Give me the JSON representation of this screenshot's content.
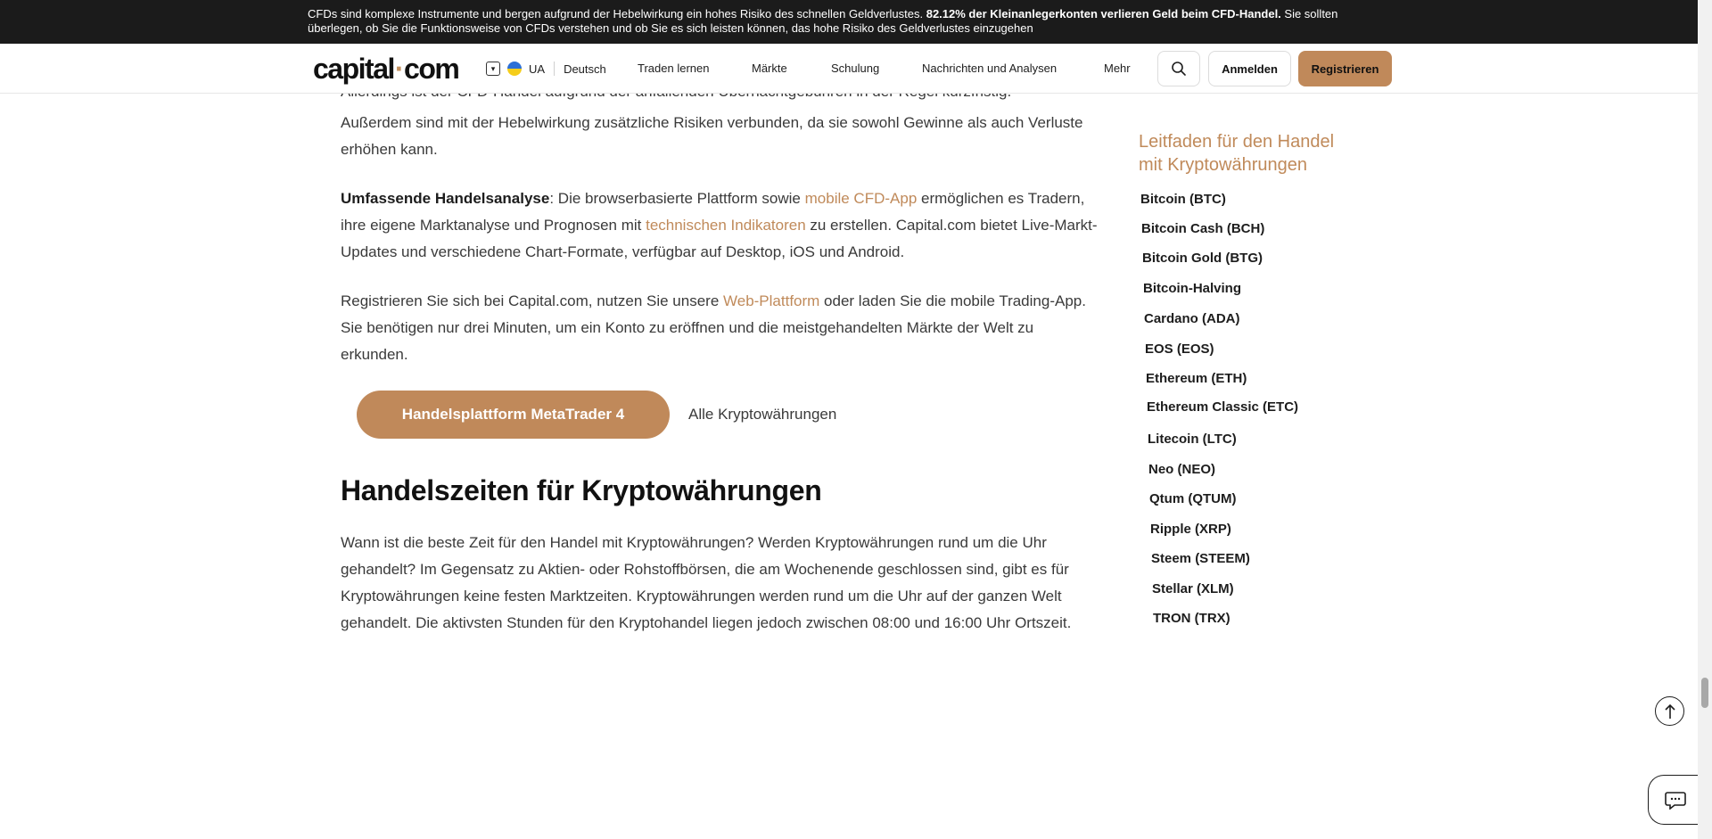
{
  "risk_banner": {
    "text_before": "CFDs sind komplexe Instrumente und bergen aufgrund der Hebelwirkung ein hohes Risiko des schnellen Geldverlustes. ",
    "text_bold": "82.12% der Kleinanlegerkonten verlieren Geld beim CFD-Handel.",
    "text_after": " Sie sollten überlegen, ob Sie die Funktionsweise von CFDs verstehen und ob Sie es sich leisten können, das hohe Risiko des Geldverlustes einzugehen"
  },
  "header": {
    "logo_left": "capital",
    "logo_dot": "·",
    "logo_right": "com",
    "region": "UA",
    "language": "Deutsch",
    "nav": [
      "Traden lernen",
      "Märkte",
      "Schulung",
      "Nachrichten und Analysen",
      "Mehr"
    ],
    "login_label": "Anmelden",
    "register_label": "Registrieren"
  },
  "article": {
    "clipped_line": "Allerdings ist der CFD-Handel aufgrund der anfallenden Übernachtgebühren in der Regel kurzfristig.",
    "para1": "Außerdem sind mit der Hebelwirkung zusätzliche Risiken verbunden, da sie sowohl Gewinne als auch Verluste erhöhen kann.",
    "para2": {
      "bold": "Umfassende Handelsanalyse",
      "t1": ": Die browserbasierte Plattform sowie ",
      "link1": "mobile CFD-App",
      "t2": " ermöglichen es Tradern, ihre eigene Marktanalyse und Prognosen mit ",
      "link2": "technischen Indikatoren",
      "t3": " zu erstellen. Capital.com bietet Live-Markt-Updates und verschiedene Chart-Formate, verfügbar auf Desktop, iOS und Android."
    },
    "para3": {
      "t1": "Registrieren Sie sich bei Capital.com, nutzen Sie unsere ",
      "link": "Web-Plattform",
      "t2": " oder laden Sie die mobile Trading-App. Sie benötigen nur drei Minuten, um ein Konto zu eröffnen und die meistgehandelten Märkte der Welt zu erkunden."
    },
    "cta_primary": "Handelsplattform MetaTrader 4",
    "cta_secondary": "Alle Kryptowährungen",
    "section_title": "Handelszeiten für Kryptowährungen",
    "section_body": "Wann ist die beste Zeit für den Handel mit Kryptowährungen? Werden Kryptowährungen rund um die Uhr gehandelt? Im Gegensatz zu Aktien- oder Rohstoffbörsen, die am Wochenende geschlossen sind, gibt es für Kryptowährungen keine festen Marktzeiten. Kryptowährungen werden rund um die Uhr auf der ganzen Welt gehandelt. Die aktivsten Stunden für den Kryptohandel liegen jedoch zwischen 08:00 und 16:00 Uhr Ortszeit."
  },
  "sidebar": {
    "title": "Leitfaden für den Handel mit Kryptowährungen",
    "items": [
      "Bitcoin (BTC)",
      "Bitcoin Cash (BCH)",
      "Bitcoin Gold (BTG)",
      "Bitcoin-Halving",
      "Cardano (ADA)",
      "EOS (EOS)",
      "Ethereum (ETH)",
      "Ethereum Classic (ETC)",
      "Litecoin (LTC)",
      "Neo (NEO)",
      "Qtum (QTUM)",
      "Ripple (XRP)",
      "Steem (STEEM)",
      "Stellar (XLM)",
      "TRON (TRX)"
    ]
  },
  "colors": {
    "accent": "#c0895a",
    "banner_bg": "#1b1b1b"
  },
  "icons": [
    "chevron-down-icon",
    "ukraine-flag-icon",
    "search-icon",
    "arrow-up-icon",
    "chat-icon"
  ]
}
